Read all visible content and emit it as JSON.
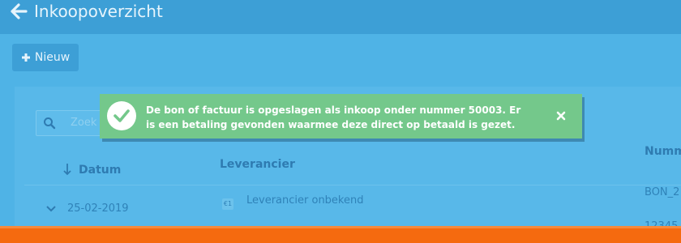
{
  "header": {
    "title": "Inkoopoverzicht",
    "back_icon": "arrow-left-icon"
  },
  "toolbar": {
    "new_label": "Nieuw",
    "new_icon": "plus-icon"
  },
  "search": {
    "placeholder": "Zoek"
  },
  "table": {
    "columns": [
      "Datum",
      "Leverancier",
      "Numm"
    ],
    "rows": [
      {
        "date": "25-02-2019",
        "supplier": "Leverancier onbekend",
        "status_icon": "€1",
        "number": "BON_2"
      },
      {
        "number": "12345"
      }
    ]
  },
  "toast": {
    "message": "De bon of factuur is opgeslagen als inkoop onder nummer 50003. Er is een betaling gevonden waarmee deze direct op betaald is gezet.",
    "type": "success",
    "close_icon": "close-icon"
  },
  "colors": {
    "background": "#4fb3e6",
    "toast": "#74c88b",
    "footer": "#f56a0f"
  }
}
